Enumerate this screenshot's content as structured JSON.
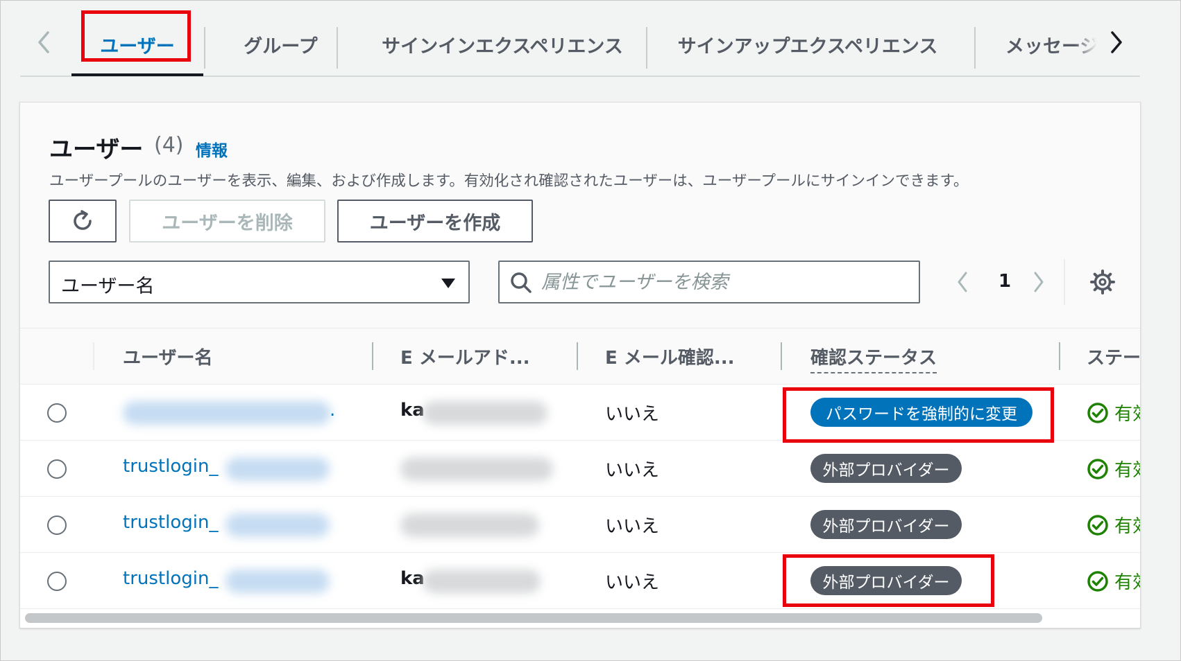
{
  "tabs": [
    {
      "label": "ユーザー"
    },
    {
      "label": "グループ"
    },
    {
      "label": "サインインエクスペリエンス"
    },
    {
      "label": "サインアップエクスペリエンス"
    },
    {
      "label": "メッセージ"
    }
  ],
  "users_panel": {
    "title": "ユーザー",
    "count": "(4)",
    "info_link": "情報",
    "description": "ユーザープールのユーザーを表示、編集、および作成します。有効化され確認されたユーザーは、ユーザープールにサインインできます。",
    "delete_label": "ユーザーを削除",
    "create_label": "ユーザーを作成",
    "filter_select": "ユーザー名",
    "search_placeholder": "属性でユーザーを検索",
    "page_number": "1"
  },
  "table": {
    "headers": [
      "ユーザー名",
      "E メールアド...",
      "E メール確認...",
      "確認ステータス",
      "ステー"
    ],
    "rows": [
      {
        "username": "",
        "username_suffix": ".",
        "email": "ka",
        "email_verified": "いいえ",
        "confirmation_status": "パスワードを強制的に変更",
        "status": "有効"
      },
      {
        "username": "trustlogin_",
        "email": "",
        "email_verified": "いいえ",
        "confirmation_status": "外部プロバイダー",
        "status": "有効"
      },
      {
        "username": "trustlogin_",
        "email": "",
        "email_verified": "いいえ",
        "confirmation_status": "外部プロバイダー",
        "status": "有効"
      },
      {
        "username": "trustlogin_",
        "email": "ka",
        "email_verified": "いいえ",
        "confirmation_status": "外部プロバイダー",
        "status": "有効"
      }
    ]
  },
  "colors": {
    "accent": "#0073bb",
    "highlight": "#e8000d",
    "badge_grey": "#545b64",
    "success": "#1d8102"
  },
  "icons": [
    "chevron-left-icon",
    "chevron-right-icon",
    "refresh-icon",
    "caret-down-icon",
    "search-icon",
    "settings-gear-icon",
    "check-circle-icon"
  ]
}
